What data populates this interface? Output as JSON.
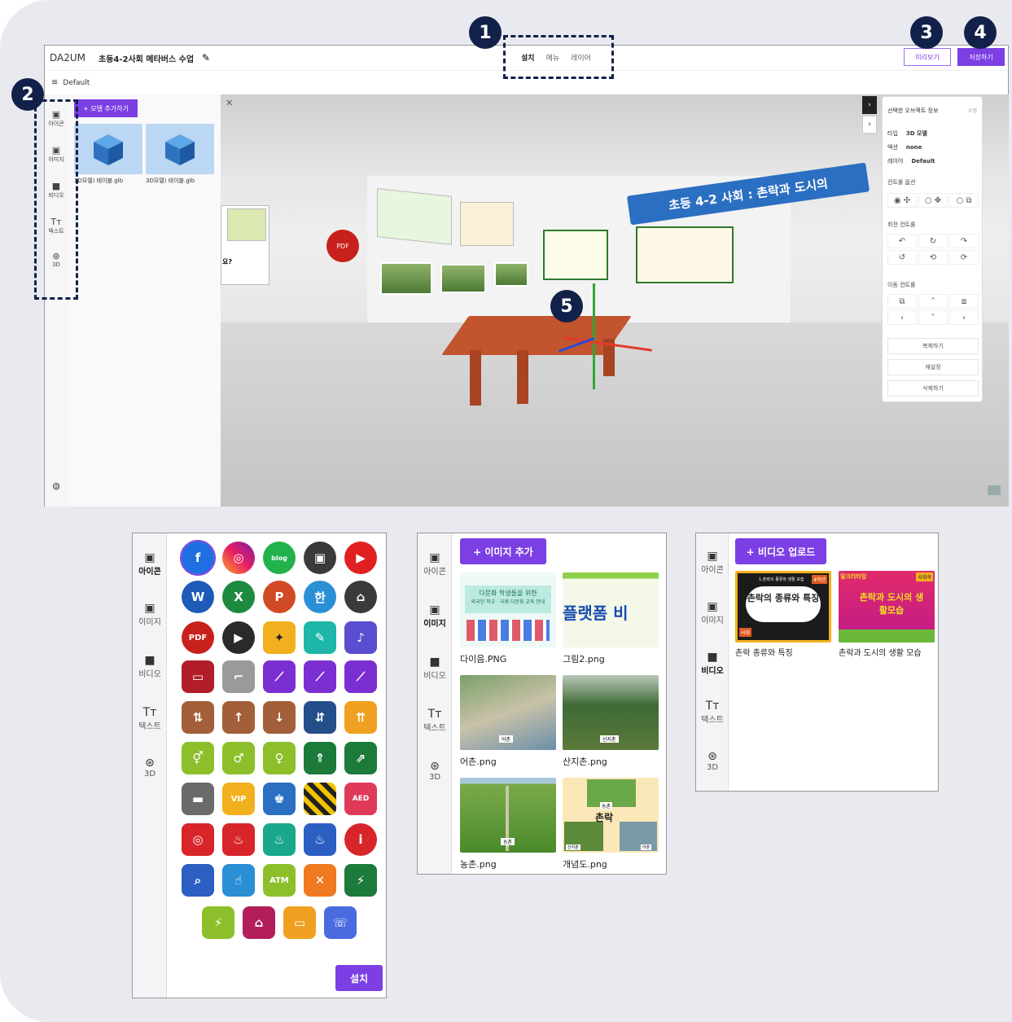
{
  "editor": {
    "logo": "DA2UM",
    "doc_title": "초등4-2사회 메타버스 수업",
    "tabs": [
      "설치",
      "메뉴",
      "레이어"
    ],
    "preview_label": "미리보기",
    "save_label": "저장하기",
    "layer_label": "Default",
    "rail": [
      "아이콘",
      "이미지",
      "비디오",
      "텍스트",
      "3D"
    ],
    "add_model_label": "+ 모델 추가하기",
    "models": [
      "3D모델) 테이블.glb",
      "3D모델) 테이블.glb"
    ],
    "banner_text": "초등 4-2 사회 : 촌락과 도시의",
    "pdf_label": "PDF",
    "question_text": "요?"
  },
  "properties": {
    "title": "선택한 오브젝트 정보",
    "edit_label": "수정",
    "type_key": "타입",
    "type_val": "3D 모델",
    "action_key": "액션",
    "action_val": "none",
    "layer_key": "레이어",
    "layer_val": "Default",
    "control_options": "컨트롤 옵션",
    "rotate_controls": "회전 컨트롤",
    "move_controls": "이동 컨트롤",
    "duplicate": "복제하기",
    "reset": "재설정",
    "delete": "삭제하기"
  },
  "markers": [
    "1",
    "2",
    "3",
    "4",
    "5"
  ],
  "icon_panel": {
    "rail": [
      "아이콘",
      "이미지",
      "비디오",
      "텍스트",
      "3D"
    ],
    "install_label": "설치",
    "tile_text": {
      "blog": "blog",
      "atm": "ATM",
      "vip": "VIP",
      "aed": "AED"
    }
  },
  "image_panel": {
    "rail": [
      "아이콘",
      "이미지",
      "비디오",
      "텍스트",
      "3D"
    ],
    "add_label": "+ 이미지 추가",
    "images": [
      "다이음.PNG",
      "그림2.png",
      "어촌.png",
      "산지촌.png",
      "농촌.png",
      "개념도.png"
    ],
    "thumb_text": {
      "dai_title": "다문화 학생들을 위한",
      "dai_sub": "외국인 학교 · 국제 다문화 교육 안내",
      "platform": "플랫폼 비",
      "fishing": "어촌",
      "mountain": "산지촌",
      "farming": "농촌",
      "concept_main": "촌락",
      "concept_top": "농촌",
      "concept_left": "산지촌",
      "concept_right": "어촌"
    }
  },
  "video_panel": {
    "rail": [
      "아이콘",
      "이미지",
      "비디오",
      "텍스트",
      "3D"
    ],
    "upload_label": "+ 비디오 업로드",
    "videos": [
      "촌락 종류와 특징",
      "촌락과 도시의 생활 모습"
    ],
    "v1_top": "1.촌락의 종류와 생활 모습",
    "v1_grade": "4학년",
    "v1_main": "촌락의 종류와 특징",
    "v1_tag": "사회",
    "v2_top": "밀크티타임",
    "v2_tag": "사회쏙",
    "v2_main": "촌락과 도시의 생활모습"
  }
}
